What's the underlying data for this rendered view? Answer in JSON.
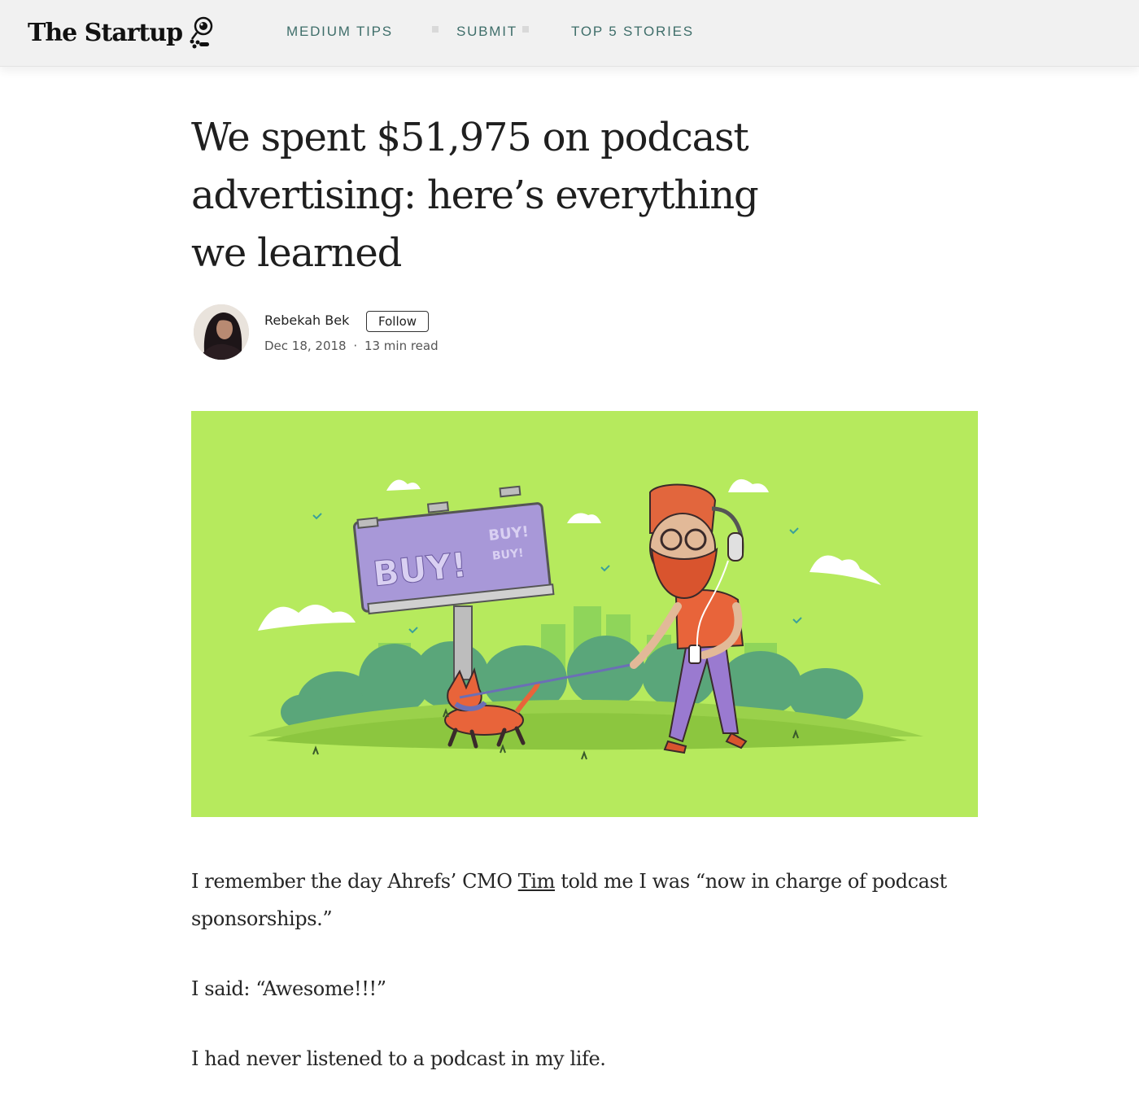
{
  "header": {
    "brand": "The Startup",
    "nav": [
      "MEDIUM TIPS",
      "SUBMIT",
      "TOP 5 STORIES"
    ]
  },
  "article": {
    "title": "We spent $51,975 on podcast advertising: here’s everything we learned",
    "author": "Rebekah Bek",
    "follow_label": "Follow",
    "date": "Dec 18, 2018",
    "read_time": "13 min read",
    "meta_separator": "·",
    "hero": {
      "billboard_text_big": "BUY!",
      "billboard_text_small_1": "BUY!",
      "billboard_text_small_2": "BUY!",
      "background_color": "#b6ea5d"
    },
    "paragraphs": {
      "p1_before": "I remember the day Ahrefs’ CMO ",
      "p1_link": "Tim",
      "p1_after": " told me I was “now in charge of podcast sponsorships.”",
      "p2": "I said: “Awesome!!!”",
      "p3": "I had never listened to a podcast in my life."
    }
  },
  "icons": {
    "brand_icon": "rocket-astronaut-icon"
  }
}
